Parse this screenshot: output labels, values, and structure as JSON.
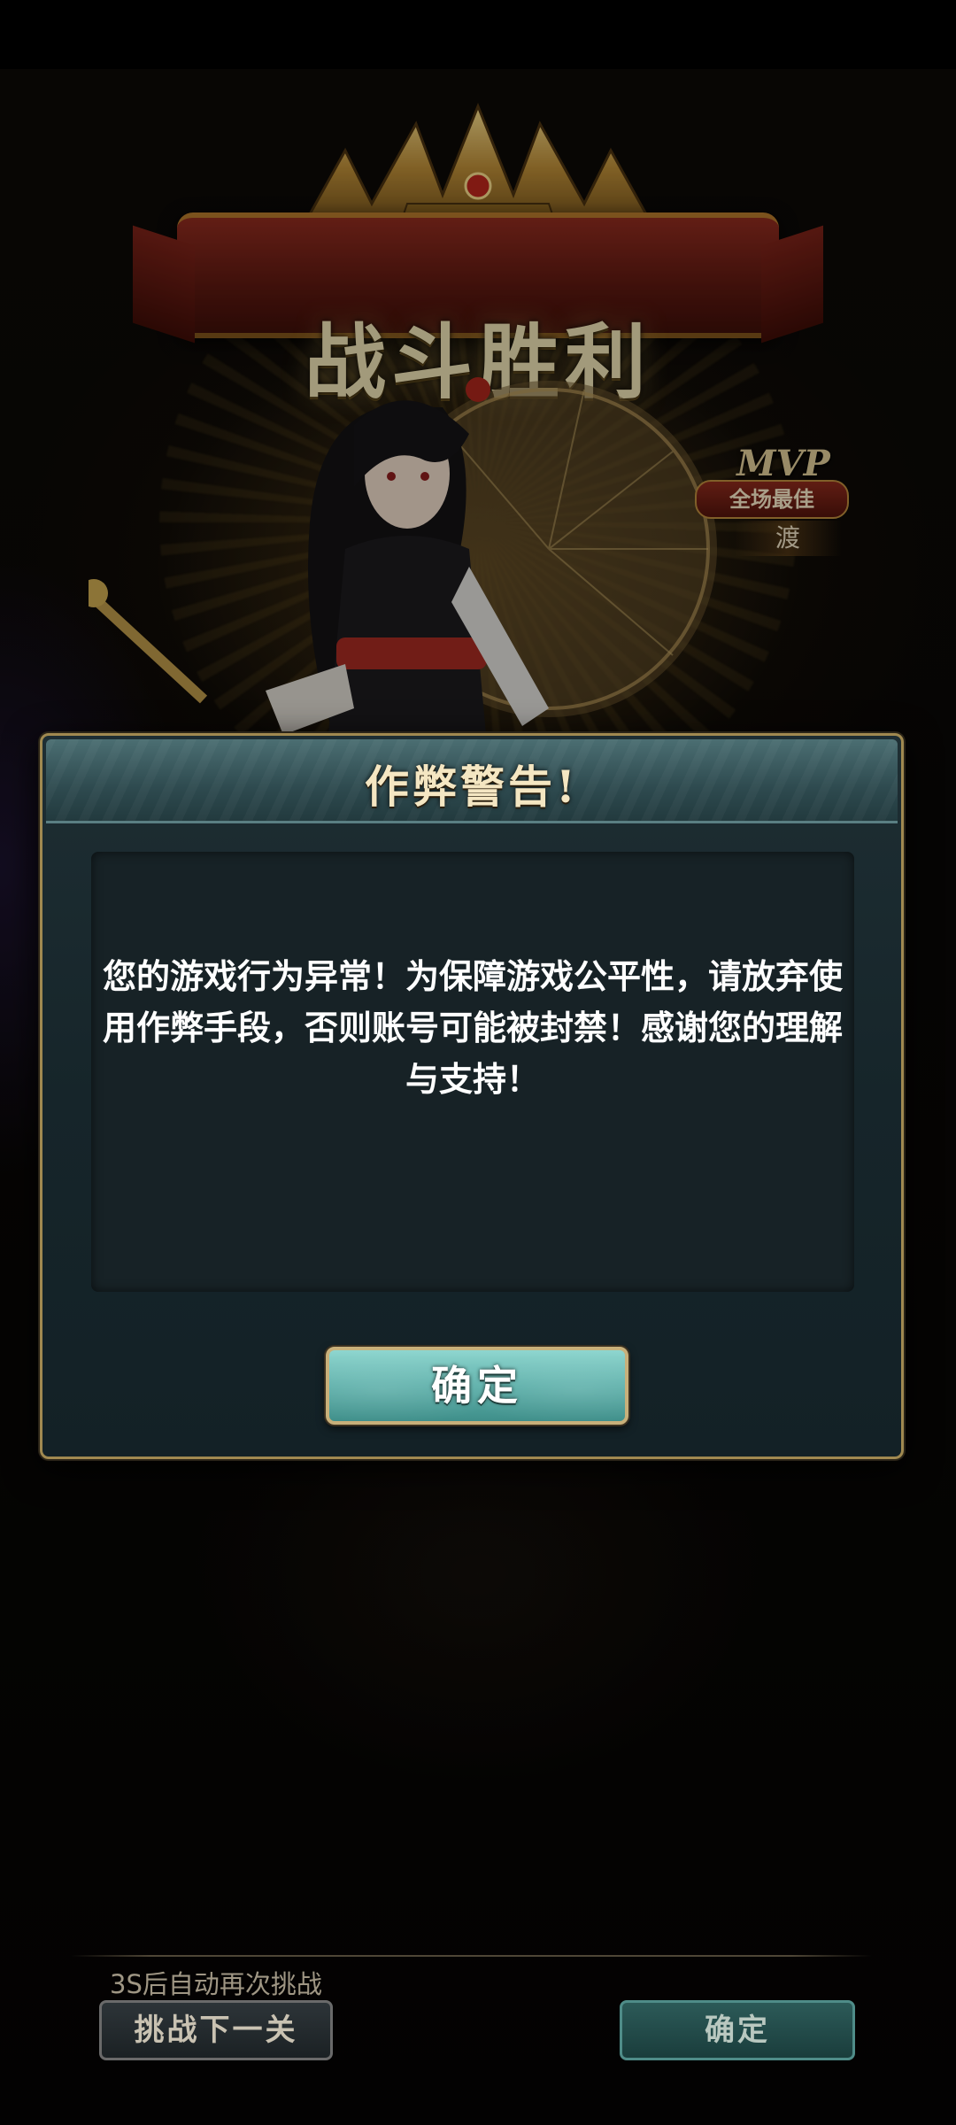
{
  "scene": {
    "victory_title": "战斗胜利",
    "mvp": {
      "label": "MVP",
      "subtitle": "全场最佳",
      "player_name": "渡"
    }
  },
  "dialog": {
    "title": "作弊警告!",
    "message": "您的游戏行为异常！为保障游戏公平性，请放弃使用作弊手段，否则账号可能被封禁！感谢您的理解与支持！",
    "confirm_label": "确定"
  },
  "bottom_bar": {
    "auto_retry_text": "3S后自动再次挑战",
    "next_level_label": "挑战下一关",
    "confirm_label": "确定"
  },
  "colors": {
    "dialog_bg": "#16252a",
    "dialog_border": "#a08950",
    "confirm_button": "#5db0aa",
    "title_text": "#f4e6c2"
  }
}
